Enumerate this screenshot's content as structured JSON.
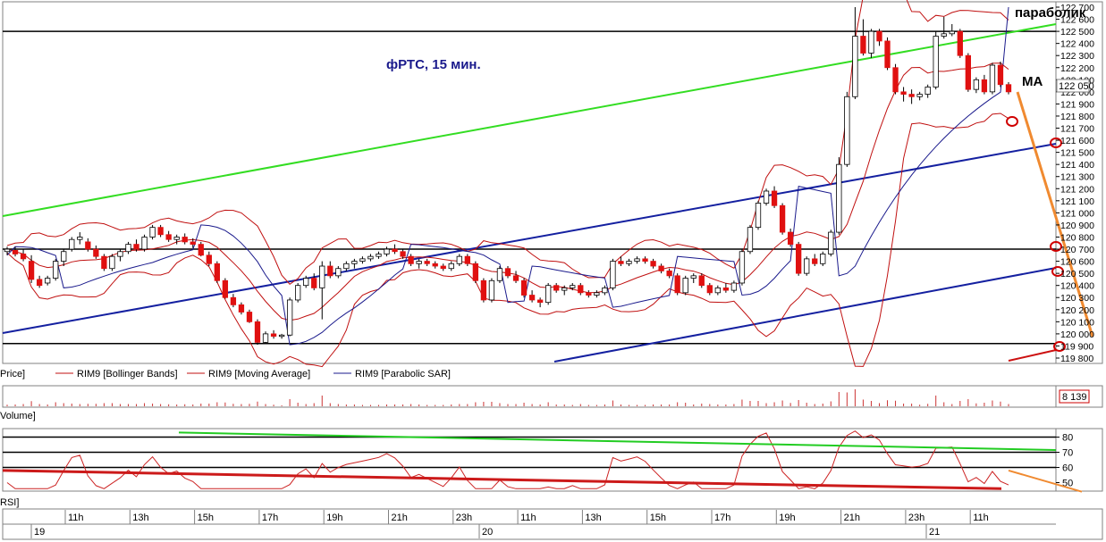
{
  "chart_data": [
    {
      "type": "candlestick",
      "title": "фРТС,  15 мин.",
      "ylim": [
        119800,
        122700
      ],
      "yticks": [
        119800,
        119900,
        120000,
        120100,
        120200,
        120300,
        120400,
        120500,
        120600,
        120700,
        120800,
        120900,
        121000,
        121100,
        121200,
        121300,
        121400,
        121500,
        121600,
        121700,
        121800,
        121900,
        122000,
        122100,
        122200,
        122300,
        122400,
        122500,
        122600,
        122700
      ],
      "ytick_labels": [
        "119 800",
        "119 900",
        "120 000",
        "120 100",
        "120 200",
        "120 300",
        "120 400",
        "120 500",
        "120 600",
        "120 700",
        "120 800",
        "120 900",
        "121 000",
        "121 100",
        "121 200",
        "121 300",
        "121 400",
        "121 500",
        "121 600",
        "121 700",
        "121 800",
        "121 900",
        "122 000",
        "122 100",
        "122 200",
        "122 300",
        "122 400",
        "122 500",
        "122 600",
        "122 700"
      ],
      "last_price_label": "122 050",
      "legend": [
        "Price]",
        "RIM9 [Bollinger Bands]",
        "RIM9 [Moving Average]",
        "RIM9 [Parabolic SAR]"
      ],
      "annotations": [
        "параболик",
        "MA"
      ],
      "horizontal_levels": [
        122500,
        120700,
        119920
      ],
      "candles_ohlc": [
        [
          120680,
          120720,
          120650,
          120700
        ],
        [
          120690,
          120720,
          120640,
          120660
        ],
        [
          120660,
          120700,
          120600,
          120620
        ],
        [
          120600,
          120650,
          120420,
          120450
        ],
        [
          120450,
          120480,
          120380,
          120400
        ],
        [
          120420,
          120480,
          120400,
          120460
        ],
        [
          120460,
          120620,
          120440,
          120600
        ],
        [
          120600,
          120700,
          120560,
          120680
        ],
        [
          120700,
          120800,
          120680,
          120780
        ],
        [
          120780,
          120840,
          120740,
          120800
        ],
        [
          120760,
          120790,
          120680,
          120700
        ],
        [
          120700,
          120730,
          120620,
          120640
        ],
        [
          120640,
          120660,
          120520,
          120540
        ],
        [
          120540,
          120660,
          120520,
          120640
        ],
        [
          120640,
          120700,
          120600,
          120680
        ],
        [
          120680,
          120760,
          120660,
          120740
        ],
        [
          120740,
          120780,
          120680,
          120700
        ],
        [
          120700,
          120820,
          120680,
          120800
        ],
        [
          120800,
          120900,
          120780,
          120880
        ],
        [
          120880,
          120900,
          120800,
          120820
        ],
        [
          120820,
          120850,
          120760,
          120780
        ],
        [
          120780,
          120820,
          120740,
          120800
        ],
        [
          120800,
          120830,
          120740,
          120760
        ],
        [
          120760,
          120790,
          120710,
          120740
        ],
        [
          120740,
          120760,
          120640,
          120650
        ],
        [
          120650,
          120680,
          120560,
          120580
        ],
        [
          120580,
          120600,
          120420,
          120440
        ],
        [
          120440,
          120460,
          120290,
          120300
        ],
        [
          120300,
          120330,
          120220,
          120240
        ],
        [
          120240,
          120260,
          120160,
          120180
        ],
        [
          120180,
          120200,
          120090,
          120100
        ],
        [
          120100,
          120120,
          119910,
          119930
        ],
        [
          119930,
          120020,
          119920,
          120000
        ],
        [
          120000,
          120030,
          119960,
          119980
        ],
        [
          119980,
          120000,
          119960,
          119990
        ],
        [
          119990,
          120300,
          119980,
          120280
        ],
        [
          120280,
          120420,
          120260,
          120400
        ],
        [
          120400,
          120480,
          120380,
          120460
        ],
        [
          120460,
          120500,
          120360,
          120380
        ],
        [
          120380,
          120600,
          120120,
          120560
        ],
        [
          120560,
          120600,
          120460,
          120480
        ],
        [
          120480,
          120560,
          120460,
          120540
        ],
        [
          120540,
          120600,
          120520,
          120580
        ],
        [
          120580,
          120620,
          120540,
          120600
        ],
        [
          120600,
          120640,
          120580,
          120620
        ],
        [
          120620,
          120660,
          120600,
          120640
        ],
        [
          120640,
          120680,
          120620,
          120660
        ],
        [
          120660,
          120720,
          120640,
          120700
        ],
        [
          120700,
          120740,
          120660,
          120680
        ],
        [
          120680,
          120700,
          120620,
          120640
        ],
        [
          120640,
          120660,
          120560,
          120580
        ],
        [
          120580,
          120620,
          120540,
          120600
        ],
        [
          120600,
          120620,
          120560,
          120580
        ],
        [
          120580,
          120600,
          120540,
          120560
        ],
        [
          120560,
          120580,
          120520,
          120540
        ],
        [
          120540,
          120600,
          120520,
          120580
        ],
        [
          120580,
          120660,
          120560,
          120640
        ],
        [
          120640,
          120660,
          120560,
          120580
        ],
        [
          120580,
          120600,
          120420,
          120440
        ],
        [
          120440,
          120460,
          120260,
          120280
        ],
        [
          120280,
          120460,
          120260,
          120440
        ],
        [
          120440,
          120560,
          120420,
          120540
        ],
        [
          120540,
          120560,
          120460,
          120480
        ],
        [
          120480,
          120520,
          120420,
          120440
        ],
        [
          120440,
          120460,
          120300,
          120320
        ],
        [
          120320,
          120360,
          120260,
          120280
        ],
        [
          120280,
          120300,
          120220,
          120260
        ],
        [
          120260,
          120420,
          120240,
          120400
        ],
        [
          120400,
          120420,
          120340,
          120360
        ],
        [
          120360,
          120400,
          120320,
          120380
        ],
        [
          120380,
          120420,
          120360,
          120400
        ],
        [
          120400,
          120420,
          120320,
          120340
        ],
        [
          120340,
          120360,
          120300,
          120320
        ],
        [
          120320,
          120360,
          120300,
          120340
        ],
        [
          120340,
          120400,
          120320,
          120380
        ],
        [
          120380,
          120620,
          120360,
          120600
        ],
        [
          120600,
          120640,
          120560,
          120580
        ],
        [
          120580,
          120620,
          120560,
          120600
        ],
        [
          120600,
          120640,
          120580,
          120620
        ],
        [
          120620,
          120640,
          120580,
          120600
        ],
        [
          120600,
          120620,
          120540,
          120560
        ],
        [
          120560,
          120580,
          120500,
          120520
        ],
        [
          120520,
          120540,
          120460,
          120480
        ],
        [
          120480,
          120500,
          120320,
          120340
        ],
        [
          120340,
          120480,
          120320,
          120460
        ],
        [
          120460,
          120500,
          120420,
          120480
        ],
        [
          120480,
          120500,
          120380,
          120400
        ],
        [
          120400,
          120420,
          120320,
          120340
        ],
        [
          120340,
          120400,
          120320,
          120380
        ],
        [
          120380,
          120420,
          120340,
          120360
        ],
        [
          120360,
          120440,
          120340,
          120420
        ],
        [
          120420,
          120700,
          120400,
          120680
        ],
        [
          120680,
          120900,
          120660,
          120880
        ],
        [
          120880,
          121100,
          120860,
          121080
        ],
        [
          121080,
          121200,
          121060,
          121180
        ],
        [
          121180,
          121220,
          121040,
          121060
        ],
        [
          121060,
          121080,
          120820,
          120840
        ],
        [
          120840,
          120870,
          120720,
          120740
        ],
        [
          120740,
          120760,
          120480,
          120500
        ],
        [
          120500,
          120640,
          120480,
          120620
        ],
        [
          120620,
          120660,
          120560,
          120580
        ],
        [
          120580,
          120680,
          120560,
          120660
        ],
        [
          120660,
          120860,
          120640,
          120840
        ],
        [
          120840,
          121460,
          120820,
          121400
        ],
        [
          121400,
          122000,
          121380,
          121960
        ],
        [
          121960,
          122700,
          121940,
          122460
        ],
        [
          122460,
          122600,
          122300,
          122320
        ],
        [
          122320,
          122520,
          122280,
          122500
        ],
        [
          122500,
          122520,
          122380,
          122420
        ],
        [
          122420,
          122450,
          122180,
          122200
        ],
        [
          122200,
          122230,
          121980,
          122000
        ],
        [
          122000,
          122040,
          121920,
          121980
        ],
        [
          121980,
          122020,
          121900,
          121960
        ],
        [
          121960,
          122000,
          121930,
          121980
        ],
        [
          121980,
          122060,
          121950,
          122040
        ],
        [
          122040,
          122500,
          122020,
          122460
        ],
        [
          122460,
          122620,
          122440,
          122480
        ],
        [
          122480,
          122560,
          122460,
          122500
        ],
        [
          122500,
          122520,
          122280,
          122300
        ],
        [
          122300,
          122320,
          122000,
          122020
        ],
        [
          122020,
          122120,
          121990,
          122100
        ],
        [
          122100,
          122140,
          121980,
          122000
        ],
        [
          122000,
          122240,
          121980,
          122220
        ],
        [
          122220,
          122250,
          122040,
          122060
        ],
        [
          122060,
          122080,
          121980,
          122000
        ]
      ]
    },
    {
      "type": "bar",
      "title": "Volume]",
      "last_value_label": "8 139"
    },
    {
      "type": "line",
      "title": "RSI]",
      "ylim": [
        45,
        85
      ],
      "yticks": [
        50,
        60,
        70,
        80
      ],
      "ytick_labels": [
        "50",
        "60",
        "70",
        "80"
      ],
      "levels": [
        80,
        70,
        60
      ]
    }
  ],
  "xaxis": {
    "time_labels": [
      "11h",
      "13h",
      "15h",
      "17h",
      "19h",
      "21h",
      "23h",
      "11h",
      "13h",
      "15h",
      "17h",
      "19h",
      "21h",
      "23h",
      "11h"
    ],
    "date_labels": [
      "19",
      "20",
      "21"
    ]
  },
  "colors": {
    "candle_body": "#e01010",
    "bollinger": "#c01010",
    "moving_average": "#c01010",
    "sar": "#1a1a8c",
    "channel": "#1420a0",
    "trendline_green": "#33dd22",
    "orange": "#f08a30",
    "rsi_ma_line": "#cc1a1a",
    "rsi_green": "#22cc22"
  }
}
